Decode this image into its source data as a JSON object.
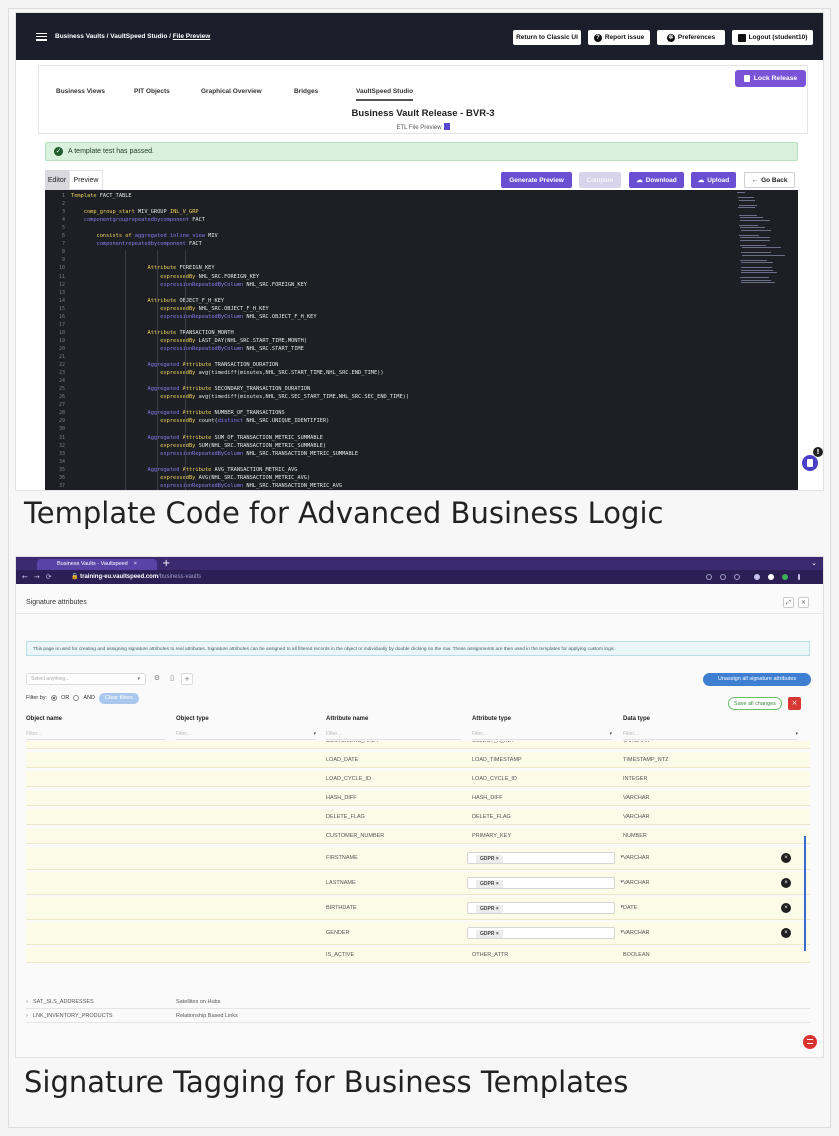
{
  "captions": {
    "shot1": "Template Code for Advanced Business Logic",
    "shot2": "Signature Tagging for Business Templates"
  },
  "shot1": {
    "breadcrumb": {
      "prefix": "Business Vaults / VaultSpeed Studio / ",
      "current": "File Preview"
    },
    "topbar_buttons": {
      "classic": "Return to Classic UI",
      "report": "Report issue",
      "prefs": "Preferences",
      "logout": "Logout (student10)"
    },
    "tabs": [
      "Business Views",
      "PIT Objects",
      "Graphical Overview",
      "Bridges",
      "VaultSpeed Studio"
    ],
    "lock_release": "Lock Release",
    "release_title": "Business Vault Release - BVR-3",
    "release_sub": "ETL File Preview",
    "alert": "A template test has passed.",
    "editor_tabs": {
      "editor": "Editor",
      "preview": "Preview"
    },
    "actions": {
      "generate": "Generate Preview",
      "compare": "Compare",
      "download": "Download",
      "upload": "Upload",
      "back": "Go Back"
    },
    "colors": {
      "accent": "#7a53d6",
      "topbar": "#1c1f2b",
      "editor_bg": "#1e1f24"
    },
    "code_lines": [
      [
        {
          "t": "Template ",
          "c": "k"
        },
        {
          "t": "FACT_TABLE",
          "c": "w"
        }
      ],
      [],
      [
        {
          "t": "    comp_group_start ",
          "c": "k"
        },
        {
          "t": "MIV_GROUP ",
          "c": "w"
        },
        {
          "t": "INL_V_GRP",
          "c": "k"
        }
      ],
      [
        {
          "t": "    componentgrouprepeatedbycomponent ",
          "c": "p"
        },
        {
          "t": "FACT",
          "c": "w"
        }
      ],
      [],
      [
        {
          "t": "        consists of ",
          "c": "k"
        },
        {
          "t": "aggregated ",
          "c": "p"
        },
        {
          "t": "inline_view ",
          "c": "p"
        },
        {
          "t": "MIV",
          "c": "w"
        }
      ],
      [
        {
          "t": "        componentrepeatedbycomponent ",
          "c": "p"
        },
        {
          "t": "FACT",
          "c": "w"
        }
      ],
      [],
      [],
      [
        {
          "t": "                        Attribute ",
          "c": "k"
        },
        {
          "t": "FOREIGN_KEY",
          "c": "w"
        }
      ],
      [
        {
          "t": "                            expressedBy ",
          "c": "k"
        },
        {
          "t": "NHL_SRC.FOREIGN_KEY",
          "c": "w"
        }
      ],
      [
        {
          "t": "                            expressionRepeatedByColumn ",
          "c": "p"
        },
        {
          "t": "NHL_SRC.FOREIGN_KEY",
          "c": "w"
        }
      ],
      [],
      [
        {
          "t": "                        Attribute ",
          "c": "k"
        },
        {
          "t": "OBJECT_F_H_KEY",
          "c": "w"
        }
      ],
      [
        {
          "t": "                            expressedBy ",
          "c": "k"
        },
        {
          "t": "NHL_SRC.OBJECT_F_H_KEY",
          "c": "w"
        }
      ],
      [
        {
          "t": "                            expressionRepeatedByColumn ",
          "c": "p"
        },
        {
          "t": "NHL_SRC.OBJECT_F_H_KEY",
          "c": "w"
        }
      ],
      [],
      [
        {
          "t": "                        Attribute ",
          "c": "k"
        },
        {
          "t": "TRANSACTION_MONTH",
          "c": "w"
        }
      ],
      [
        {
          "t": "                            expressedBy ",
          "c": "k"
        },
        {
          "t": "LAST_DAY(NHL_SRC.START_TIME,MONTH)",
          "c": "w"
        }
      ],
      [
        {
          "t": "                            expressionRepeatedByColumn ",
          "c": "p"
        },
        {
          "t": "NHL_SRC.START_TIME",
          "c": "w"
        }
      ],
      [],
      [
        {
          "t": "                        Aggregated ",
          "c": "p"
        },
        {
          "t": "Attribute ",
          "c": "k"
        },
        {
          "t": "TRANSACTION_DURATION",
          "c": "w"
        }
      ],
      [
        {
          "t": "                            expressedBy ",
          "c": "k"
        },
        {
          "t": "avg(timediff(minutes,NHL_SRC.START_TIME,NHL_SRC.END_TIME))",
          "c": "w"
        }
      ],
      [],
      [
        {
          "t": "                        Aggregated ",
          "c": "p"
        },
        {
          "t": "Attribute ",
          "c": "k"
        },
        {
          "t": "SECONDARY_TRANSACTION_DURATION",
          "c": "w"
        }
      ],
      [
        {
          "t": "                            expressedBy ",
          "c": "k"
        },
        {
          "t": "avg(timediff(minutes,NHL_SRC.SEC_START_TIME,NHL_SRC.SEC_END_TIME))",
          "c": "w"
        }
      ],
      [],
      [
        {
          "t": "                        Aggregated ",
          "c": "p"
        },
        {
          "t": "Attribute ",
          "c": "k"
        },
        {
          "t": "NUMBER_OF_TRANSACTIONS",
          "c": "w"
        }
      ],
      [
        {
          "t": "                            expressedBy ",
          "c": "k"
        },
        {
          "t": "count(",
          "c": "w"
        },
        {
          "t": "distinct ",
          "c": "p"
        },
        {
          "t": "NHL_SRC.UNIQUE_IDENTIFIER)",
          "c": "w"
        }
      ],
      [],
      [
        {
          "t": "                        Aggregated ",
          "c": "p"
        },
        {
          "t": "Attribute ",
          "c": "k"
        },
        {
          "t": "SUM_OF_TRANSACTION_METRIC_SUMMABLE",
          "c": "w"
        }
      ],
      [
        {
          "t": "                            expressedBy ",
          "c": "k"
        },
        {
          "t": "SUM(NHL_SRC.TRANSACTION_METRIC_SUMMABLE)",
          "c": "w"
        }
      ],
      [
        {
          "t": "                            expressionRepeatedByColumn ",
          "c": "p"
        },
        {
          "t": "NHL_SRC.TRANSACTION_METRIC_SUMMABLE",
          "c": "w"
        }
      ],
      [],
      [
        {
          "t": "                        Aggregated ",
          "c": "p"
        },
        {
          "t": "Attribute ",
          "c": "k"
        },
        {
          "t": "AVG_TRANSACTION_METRIC_AVG",
          "c": "w"
        }
      ],
      [
        {
          "t": "                            expressedBy ",
          "c": "k"
        },
        {
          "t": "AVG(NHL_SRC.TRANSACTION_METRIC_AVG)",
          "c": "w"
        }
      ],
      [
        {
          "t": "                            expressionRepeatedByColumn ",
          "c": "p"
        },
        {
          "t": "NHL_SRC.TRANSACTION_METRIC_AVG",
          "c": "w"
        }
      ]
    ]
  },
  "shot2": {
    "browser": {
      "tab_title": "Business Vaults - Vaultspeed",
      "url_host": "training-eu.vaultspeed.com",
      "url_path": "/business-vaults"
    },
    "panel_title": "Signature attributes",
    "info_text": "This page is used for creating and assigning signature attributes to real attributes. Signature attributes can be assigned to all filtered records in the object or individually by double clicking on the row. These assignments are then used in the templates for applying custom logic.",
    "select_placeholder": "Select anything...",
    "unassign": "Unassign all signature attributes",
    "filter": {
      "label": "Filter by:",
      "or": "OR",
      "and": "AND",
      "clear": "Clear filters"
    },
    "save_all": "Save all changes",
    "columns": [
      "Object name",
      "Object type",
      "Attribute name",
      "Attribute type",
      "Data type"
    ],
    "filter_placeholder": "Filter...",
    "rows": [
      {
        "attr": "CUSTOMERS_HKEY",
        "type": "OBJECT_H_KEY",
        "dtype": "VARCHAR",
        "gdpr": false
      },
      {
        "attr": "LOAD_DATE",
        "type": "LOAD_TIMESTAMP",
        "dtype": "TIMESTAMP_NTZ",
        "gdpr": false
      },
      {
        "attr": "LOAD_CYCLE_ID",
        "type": "LOAD_CYCLE_ID",
        "dtype": "INTEGER",
        "gdpr": false
      },
      {
        "attr": "HASH_DIFF",
        "type": "HASH_DIFF",
        "dtype": "VARCHAR",
        "gdpr": false
      },
      {
        "attr": "DELETE_FLAG",
        "type": "DELETE_FLAG",
        "dtype": "VARCHAR",
        "gdpr": false
      },
      {
        "attr": "CUSTOMER_NUMBER",
        "type": "PRIMARY_KEY",
        "dtype": "NUMBER",
        "gdpr": false
      },
      {
        "attr": "FIRSTNAME",
        "type": "GDPR",
        "dtype": "VARCHAR",
        "gdpr": true
      },
      {
        "attr": "LASTNAME",
        "type": "GDPR",
        "dtype": "VARCHAR",
        "gdpr": true
      },
      {
        "attr": "BIRTHDATE",
        "type": "GDPR",
        "dtype": "DATE",
        "gdpr": true
      },
      {
        "attr": "GENDER",
        "type": "GDPR",
        "dtype": "VARCHAR",
        "gdpr": true
      },
      {
        "attr": "IS_ACTIVE",
        "type": "OTHER_ATTR",
        "dtype": "BOOLEAN",
        "gdpr": false
      }
    ],
    "groups": [
      {
        "name": "SAT_SLS_ADDRESSES",
        "type": "Satellites on Hubs"
      },
      {
        "name": "LNK_INVENTORY_PRODUCTS",
        "type": "Relationship Based Links"
      }
    ],
    "colors": {
      "chrome": "#3b2a70",
      "unassign": "#3e7fd1",
      "danger": "#d63a33"
    }
  }
}
